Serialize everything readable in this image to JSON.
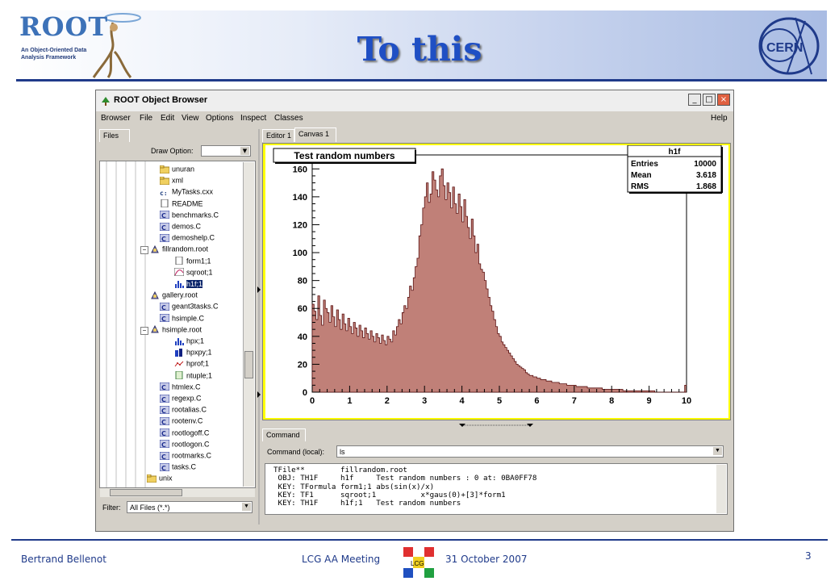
{
  "slide": {
    "title": "To this",
    "root_logo_text": "ROOT",
    "root_logo_subtitle": "An Object-Oriented Data Analysis Framework",
    "cern_logo_text": "CERN",
    "footer_author": "Bertrand Bellenot",
    "footer_meeting": "LCG AA Meeting",
    "footer_date": "31 October 2007",
    "page_number": "3",
    "lcg_logo_text": "LCG"
  },
  "window": {
    "title": "ROOT Object Browser",
    "menu": [
      "Browser",
      "File",
      "Edit",
      "View",
      "Options",
      "Inspect",
      "Classes"
    ],
    "help": "Help",
    "buttons": {
      "minimize": "_",
      "maximize": "□",
      "close": "×"
    }
  },
  "left_panel": {
    "tab": "Files",
    "draw_option_label": "Draw Option:",
    "draw_option_value": "",
    "filter_label": "Filter:",
    "filter_value": "All Files (*.*)",
    "tree": [
      {
        "label": "unuran",
        "icon": "folder"
      },
      {
        "label": "xml",
        "icon": "folder"
      },
      {
        "label": "MyTasks.cxx",
        "icon": "cxx-file"
      },
      {
        "label": "README",
        "icon": "text-file"
      },
      {
        "label": "benchmarks.C",
        "icon": "macro"
      },
      {
        "label": "demos.C",
        "icon": "macro"
      },
      {
        "label": "demoshelp.C",
        "icon": "macro"
      },
      {
        "label": "fillrandom.root",
        "icon": "root-file"
      },
      {
        "label": "form1;1",
        "icon": "formula"
      },
      {
        "label": "sqroot;1",
        "icon": "function"
      },
      {
        "label": "h1f;1",
        "icon": "histogram",
        "selected": true
      },
      {
        "label": "gallery.root",
        "icon": "root-file"
      },
      {
        "label": "geant3tasks.C",
        "icon": "macro"
      },
      {
        "label": "hsimple.C",
        "icon": "macro"
      },
      {
        "label": "hsimple.root",
        "icon": "root-file"
      },
      {
        "label": "hpx;1",
        "icon": "histogram"
      },
      {
        "label": "hpxpy;1",
        "icon": "histogram-2d"
      },
      {
        "label": "hprof;1",
        "icon": "profile"
      },
      {
        "label": "ntuple;1",
        "icon": "ntuple"
      },
      {
        "label": "htmlex.C",
        "icon": "macro"
      },
      {
        "label": "regexp.C",
        "icon": "macro"
      },
      {
        "label": "rootalias.C",
        "icon": "macro"
      },
      {
        "label": "rootenv.C",
        "icon": "macro"
      },
      {
        "label": "rootlogoff.C",
        "icon": "macro"
      },
      {
        "label": "rootlogon.C",
        "icon": "macro"
      },
      {
        "label": "rootmarks.C",
        "icon": "macro"
      },
      {
        "label": "tasks.C",
        "icon": "macro"
      },
      {
        "label": "unix",
        "icon": "folder"
      }
    ]
  },
  "right_panel": {
    "tabs": [
      "Editor 1",
      "Canvas 1"
    ],
    "command_tab": "Command",
    "command_label": "Command (local):",
    "command_value": "ls",
    "console_lines": [
      "TFile**        fillrandom.root",
      " OBJ: TH1F     h1f     Test random numbers : 0 at: 0BA0FF78",
      " KEY: TFormula form1;1 abs(sin(x)/x)",
      " KEY: TF1      sqroot;1          x*gaus(0)+[3]*form1",
      " KEY: TH1F     h1f;1   Test random numbers"
    ]
  },
  "stats": {
    "name": "h1f",
    "rows": [
      {
        "label": "Entries",
        "value": "10000"
      },
      {
        "label": "Mean",
        "value": "3.618"
      },
      {
        "label": "RMS",
        "value": "1.868"
      }
    ]
  },
  "chart_data": {
    "type": "bar",
    "title": "Test random numbers",
    "xlim": [
      0,
      10
    ],
    "ylim": [
      0,
      170
    ],
    "xticks": [
      0,
      1,
      2,
      3,
      4,
      5,
      6,
      7,
      8,
      9,
      10
    ],
    "yticks": [
      0,
      20,
      40,
      60,
      80,
      100,
      120,
      140,
      160
    ],
    "grid": false,
    "bar_color": "#c08078",
    "bin_width": 0.05,
    "values": [
      63,
      58,
      52,
      69,
      55,
      48,
      66,
      60,
      57,
      50,
      62,
      54,
      47,
      59,
      52,
      45,
      56,
      49,
      44,
      53,
      47,
      42,
      50,
      46,
      40,
      48,
      44,
      39,
      46,
      42,
      38,
      44,
      40,
      36,
      42,
      39,
      35,
      41,
      37,
      34,
      40,
      38,
      36,
      44,
      41,
      47,
      52,
      49,
      57,
      62,
      60,
      68,
      76,
      73,
      82,
      90,
      96,
      112,
      120,
      132,
      140,
      150,
      136,
      142,
      158,
      152,
      145,
      140,
      155,
      160,
      148,
      138,
      150,
      143,
      132,
      147,
      135,
      128,
      142,
      133,
      122,
      138,
      126,
      118,
      110,
      124,
      112,
      100,
      106,
      92,
      88,
      86,
      80,
      74,
      68,
      62,
      58,
      52,
      47,
      42,
      40,
      36,
      34,
      32,
      30,
      28,
      26,
      24,
      22,
      20,
      19,
      18,
      17,
      16,
      14,
      13,
      12,
      12,
      11,
      11,
      10,
      10,
      9,
      9,
      9,
      8,
      8,
      8,
      7,
      7,
      7,
      7,
      6,
      6,
      6,
      6,
      5,
      5,
      5,
      5,
      5,
      4,
      4,
      4,
      4,
      4,
      4,
      3,
      3,
      3,
      3,
      3,
      3,
      3,
      3,
      2,
      2,
      2,
      2,
      2,
      2,
      2,
      2,
      2,
      2,
      2,
      1,
      1,
      1,
      1,
      1,
      1,
      1,
      1,
      1,
      1,
      1,
      1,
      1,
      1,
      1,
      1,
      1,
      0,
      0,
      0,
      0,
      0,
      0,
      0,
      0,
      0,
      0,
      0,
      0,
      0,
      0,
      0,
      0,
      5
    ]
  }
}
